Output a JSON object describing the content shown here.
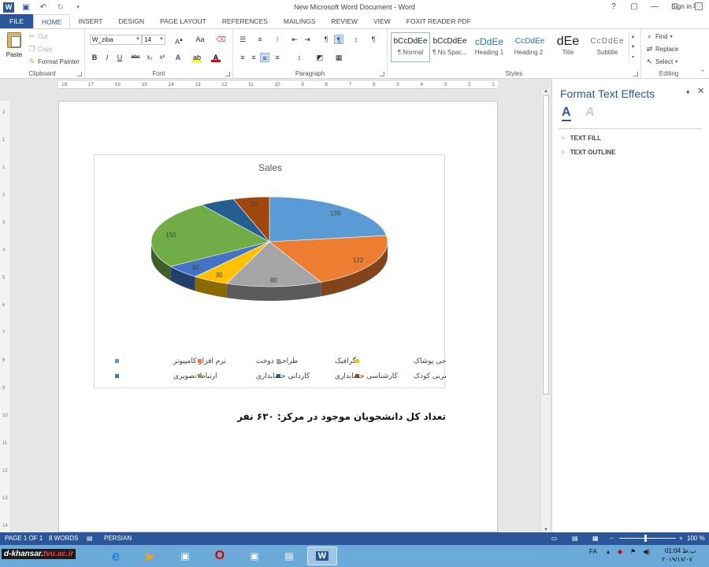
{
  "window": {
    "title": "New Microsoft Word Document - Word",
    "signin": "Sign in",
    "controls": [
      "?",
      "▢",
      "—",
      "▢",
      "✕"
    ]
  },
  "tabs": [
    {
      "label": "FILE"
    },
    {
      "label": "HOME"
    },
    {
      "label": "INSERT"
    },
    {
      "label": "DESIGN"
    },
    {
      "label": "PAGE LAYOUT"
    },
    {
      "label": "REFERENCES"
    },
    {
      "label": "MAILINGS"
    },
    {
      "label": "REVIEW"
    },
    {
      "label": "VIEW"
    },
    {
      "label": "FOXIT READER PDF"
    }
  ],
  "ribbon": {
    "clipboard": {
      "paste": "Paste",
      "cut": "Cut",
      "copy": "Copy",
      "format_painter": "Format Painter",
      "label": "Clipboard"
    },
    "font": {
      "name": "W_ziba",
      "size": "14",
      "label": "Font"
    },
    "paragraph": {
      "label": "Paragraph"
    },
    "styles": {
      "label": "Styles",
      "items": [
        {
          "sample": "bCcDdEe",
          "name": "¶ Normal"
        },
        {
          "sample": "bCcDdEe",
          "name": "¶ No Spac..."
        },
        {
          "sample": "cDdEe",
          "name": "Heading 1"
        },
        {
          "sample": "·CcDdEe",
          "name": "Heading 2"
        },
        {
          "sample": "dEe",
          "name": "Title"
        },
        {
          "sample": "CcDdEe",
          "name": "Subtitle"
        }
      ]
    },
    "editing": {
      "find": "Find",
      "replace": "Replace",
      "select": "Select",
      "label": "Editing"
    }
  },
  "ruler": {
    "numbers": [
      "18",
      "17",
      "16",
      "15",
      "14",
      "13",
      "12",
      "11",
      "10",
      "9",
      "8",
      "7",
      "6",
      "5",
      "4",
      "3",
      "2",
      "1"
    ]
  },
  "vruler": {
    "numbers": [
      "2",
      "1",
      "1",
      "2",
      "3",
      "4",
      "5",
      "6",
      "7",
      "8",
      "9",
      "10",
      "11",
      "12",
      "13",
      "14"
    ]
  },
  "chart_data": {
    "type": "pie",
    "title": "Sales",
    "labels": [
      "نرم افزار کامپیوتر",
      "طراحی دوخت",
      "گرافیک",
      "طراحی پوشاک",
      "ارتباط تصویری",
      "کاردانی حسابداری",
      "کارشناسی حسابداری",
      "مربی کودک"
    ],
    "values": [
      139,
      122,
      80,
      30,
      30,
      150,
      29,
      30
    ],
    "value_labels": [
      "139",
      "122",
      "80",
      "30",
      "30",
      "150",
      "",
      "30"
    ],
    "colors": [
      "#5b9bd5",
      "#ed7d31",
      "#a5a5a5",
      "#ffc000",
      "#4472c4",
      "#70ad47",
      "#255e91",
      "#9e480e"
    ],
    "legend_position": "bottom"
  },
  "document": {
    "text": "تعداد کل دانشجویان موجود در مرکز: ۶۳۰ نفر"
  },
  "panel": {
    "title": "Format Text Effects",
    "sections": [
      "TEXT FILL",
      "TEXT OUTLINE"
    ]
  },
  "status": {
    "page": "PAGE 1 OF 1",
    "words": "8 WORDS",
    "language": "PERSIAN",
    "zoom": "100 %"
  },
  "taskbar": {
    "watermark_a": "d-khansar.",
    "watermark_b": "tvu.ac.ir",
    "lang": "FA",
    "time": "01:04 ب.ظ",
    "date": "۲۰۱۹/۱۷/۰۷"
  }
}
